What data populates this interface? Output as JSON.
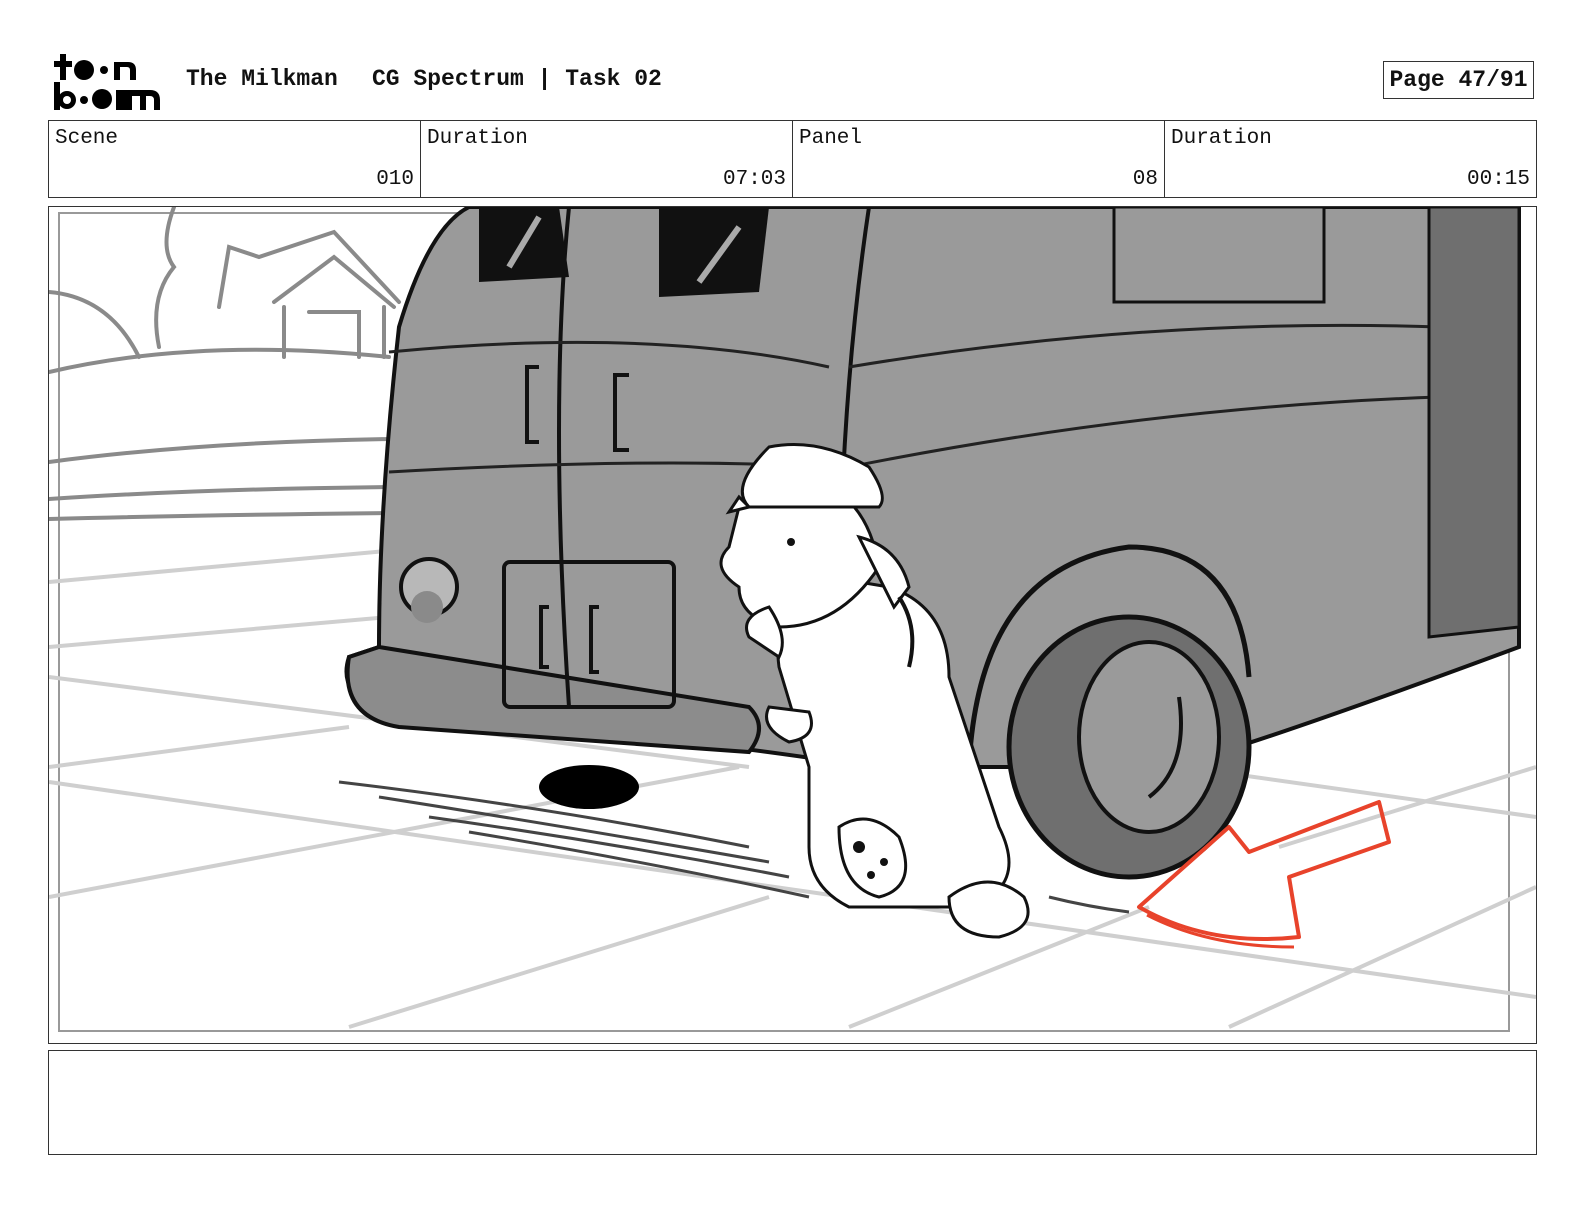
{
  "header": {
    "logo_alt": "toon boom",
    "show_title": "The Milkman",
    "project_title": "CG Spectrum | Task 02",
    "page_label": "Page 47/91"
  },
  "info": {
    "scene_label": "Scene",
    "scene_value": "010",
    "scene_duration_label": "Duration",
    "scene_duration_value": "07:03",
    "panel_label": "Panel",
    "panel_value": "08",
    "panel_duration_label": "Duration",
    "panel_duration_value": "00:15"
  },
  "panel": {
    "drawing": "milk-truck-storyboard-sketch",
    "accent_color": "#e8432b",
    "truck_color": "#9a9a9a"
  },
  "notes": {
    "text": ""
  }
}
